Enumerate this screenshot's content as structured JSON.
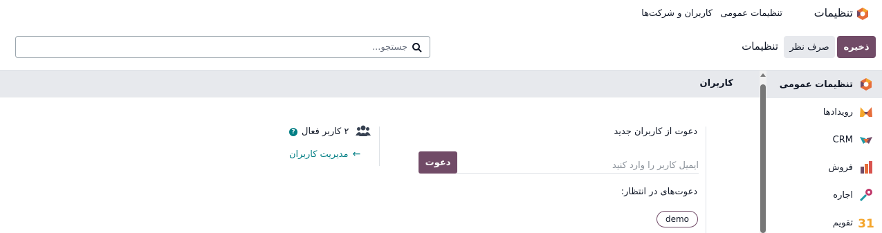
{
  "topnav": {
    "app_title": "تنظیمات",
    "menu": [
      "تنظیمات عمومی",
      "کاربران و شرکت‌ها"
    ]
  },
  "control_panel": {
    "save_label": "ذخیره",
    "discard_label": "صرف نظر",
    "breadcrumb": "تنظیمات",
    "search_placeholder": "جستجو..."
  },
  "sidebar": {
    "items": [
      {
        "label": "تنظیمات عمومی",
        "icon": "settings-icon",
        "active": true
      },
      {
        "label": "رویدادها",
        "icon": "events-icon"
      },
      {
        "label": "CRM",
        "icon": "crm-icon"
      },
      {
        "label": "فروش",
        "icon": "sales-icon"
      },
      {
        "label": "اجاره",
        "icon": "rental-icon"
      },
      {
        "label": "تقویم",
        "icon": "calendar-icon"
      }
    ]
  },
  "section": {
    "title": "کاربران",
    "invite_title": "دعوت از کاربران جدید",
    "invite_placeholder": "ایمیل کاربر را وارد کنید",
    "invite_button": "دعوت",
    "pending_title": "دعوت‌های در انتظار:",
    "pending_tags": [
      "demo"
    ],
    "active_users": "۲ کاربر فعال",
    "manage_users": "مدیریت کاربران"
  },
  "colors": {
    "brand": "#714B67",
    "link": "#017e84"
  }
}
